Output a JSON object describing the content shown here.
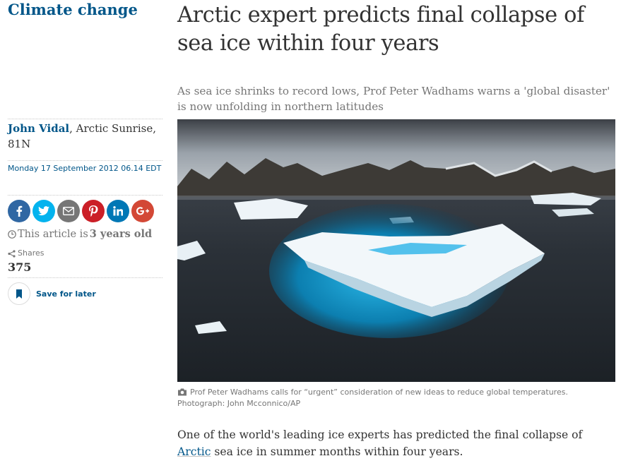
{
  "section": {
    "label": "Climate change"
  },
  "headline": "Arctic expert predicts final collapse of sea ice within four years",
  "standfirst": "As sea ice shrinks to record lows, Prof Peter Wadhams warns a 'global disaster' is now unfolding in northern latitudes",
  "byline": {
    "author": "John Vidal",
    "location": ", Arctic Sunrise, 81N"
  },
  "dateline": "Monday 17 September 2012 06.14 EDT",
  "share_buttons": [
    {
      "name": "facebook",
      "icon": "facebook-icon",
      "color": "#3067a3"
    },
    {
      "name": "twitter",
      "icon": "twitter-icon",
      "color": "#03b3ee"
    },
    {
      "name": "email",
      "icon": "email-icon",
      "color": "#767676"
    },
    {
      "name": "pinterest",
      "icon": "pinterest-icon",
      "color": "#cb1f27"
    },
    {
      "name": "linkedin",
      "icon": "linkedin-icon",
      "color": "#0077b5"
    },
    {
      "name": "googleplus",
      "icon": "google-plus-icon",
      "color": "#d34836"
    }
  ],
  "article_age": {
    "prefix": "This article is",
    "age": "3 years old"
  },
  "shares": {
    "label": "Shares",
    "count": "375"
  },
  "save": {
    "label": "Save for later"
  },
  "image": {
    "icon": "camera-icon"
  },
  "caption": "Prof Peter Wadhams calls for “urgent” consideration of new ideas to reduce global temperatures. Photograph: John Mcconnico/AP",
  "body": {
    "before_link": "One of the world's leading ice experts has predicted the final collapse of ",
    "link": "Arctic",
    "after_link": " sea ice in summer months within four years."
  },
  "colors": {
    "brand": "#005689",
    "text": "#333333",
    "muted": "#767676"
  }
}
